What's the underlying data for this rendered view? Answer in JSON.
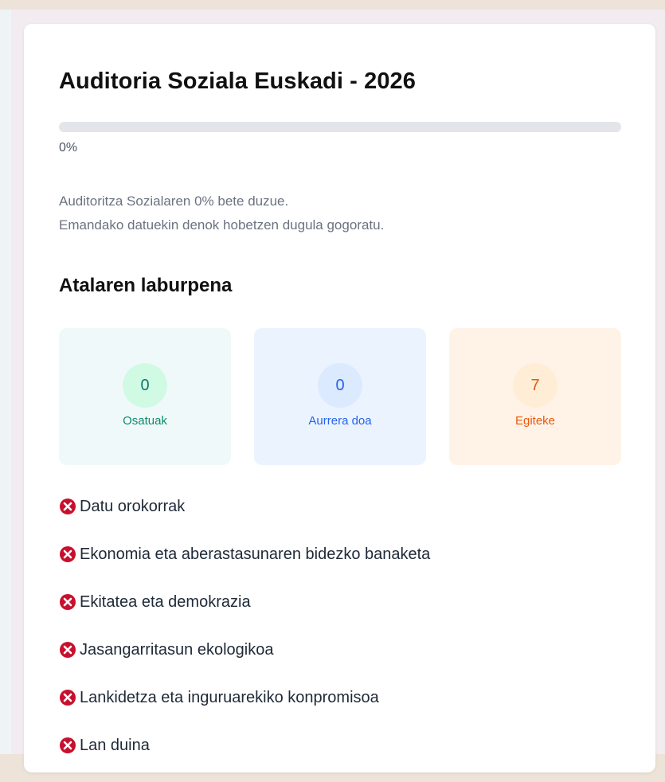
{
  "header": {
    "title": "Auditoria Soziala Euskadi - 2026"
  },
  "progress": {
    "value_percent": 0,
    "label": "0%"
  },
  "description": {
    "line1": "Auditoritza Sozialaren 0% bete duzue.",
    "line2": "Emandako datuekin denok hobetzen dugula gogoratu."
  },
  "summary": {
    "title": "Atalaren laburpena",
    "stats": {
      "completed": {
        "count": "0",
        "label": "Osatuak",
        "color": "#0f8a6c"
      },
      "in_progress": {
        "count": "0",
        "label": "Aurrera doa",
        "color": "#2563eb"
      },
      "pending": {
        "count": "7",
        "label": "Egiteke",
        "color": "#ea580c"
      }
    }
  },
  "sections": [
    {
      "label": "Datu orokorrak",
      "status": "incomplete",
      "icon": "x-circle-icon"
    },
    {
      "label": "Ekonomia eta aberastasunaren bidezko banaketa",
      "status": "incomplete",
      "icon": "x-circle-icon"
    },
    {
      "label": "Ekitatea eta demokrazia",
      "status": "incomplete",
      "icon": "x-circle-icon"
    },
    {
      "label": "Jasangarritasun ekologikoa",
      "status": "incomplete",
      "icon": "x-circle-icon"
    },
    {
      "label": "Lankidetza eta inguruarekiko konpromisoa",
      "status": "incomplete",
      "icon": "x-circle-icon"
    },
    {
      "label": "Lan duina",
      "status": "incomplete",
      "icon": "x-circle-icon"
    }
  ],
  "colors": {
    "incomplete_icon": "#c8102e",
    "progress_fill": "#3b82f6"
  }
}
